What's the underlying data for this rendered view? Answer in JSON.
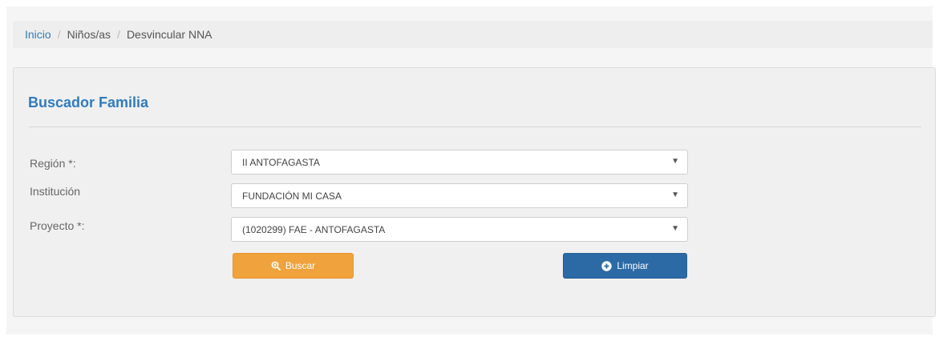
{
  "breadcrumb": {
    "items": [
      "Inicio",
      "Niños/as",
      "Desvincular NNA"
    ],
    "separator": "/"
  },
  "panel": {
    "title": "Buscador Familia"
  },
  "form": {
    "region_label": "Región *:",
    "region_value": "II ANTOFAGASTA",
    "institucion_label": "Institución",
    "institucion_value": "FUNDACIÓN MI CASA",
    "proyecto_label": "Proyecto *:",
    "proyecto_value": "(1020299) FAE - ANTOFAGASTA"
  },
  "buttons": {
    "search_label": "Buscar",
    "search_icon": "zoom-in-icon",
    "clear_label": "Limpiar",
    "clear_icon": "plus-circle-icon"
  },
  "colors": {
    "link": "#337ab7",
    "title": "#2f7bbf",
    "search_button": "#f0a23c",
    "clear_button": "#2c6aa6"
  }
}
